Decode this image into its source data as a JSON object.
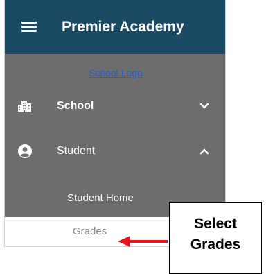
{
  "header": {
    "menu_icon": "hamburger-icon",
    "title": "Premier Academy",
    "background": "#1b4a64"
  },
  "logo_link": "School Logo",
  "nav": [
    {
      "label": "School",
      "icon": "building-icon",
      "chevron": "chevron-down-icon",
      "expanded": false
    },
    {
      "label": "Student",
      "icon": "user-circle-icon",
      "chevron": "chevron-up-icon",
      "expanded": true
    }
  ],
  "student_submenu": [
    {
      "label": "Student Home",
      "selected": false
    },
    {
      "label": "Grades",
      "selected": true
    }
  ],
  "annotation": {
    "line1": "Select",
    "line2": "Grades",
    "arrow_color": "#e8141c"
  },
  "colors": {
    "sidebar": "#6d6d6d",
    "link": "#1e5fd8"
  }
}
